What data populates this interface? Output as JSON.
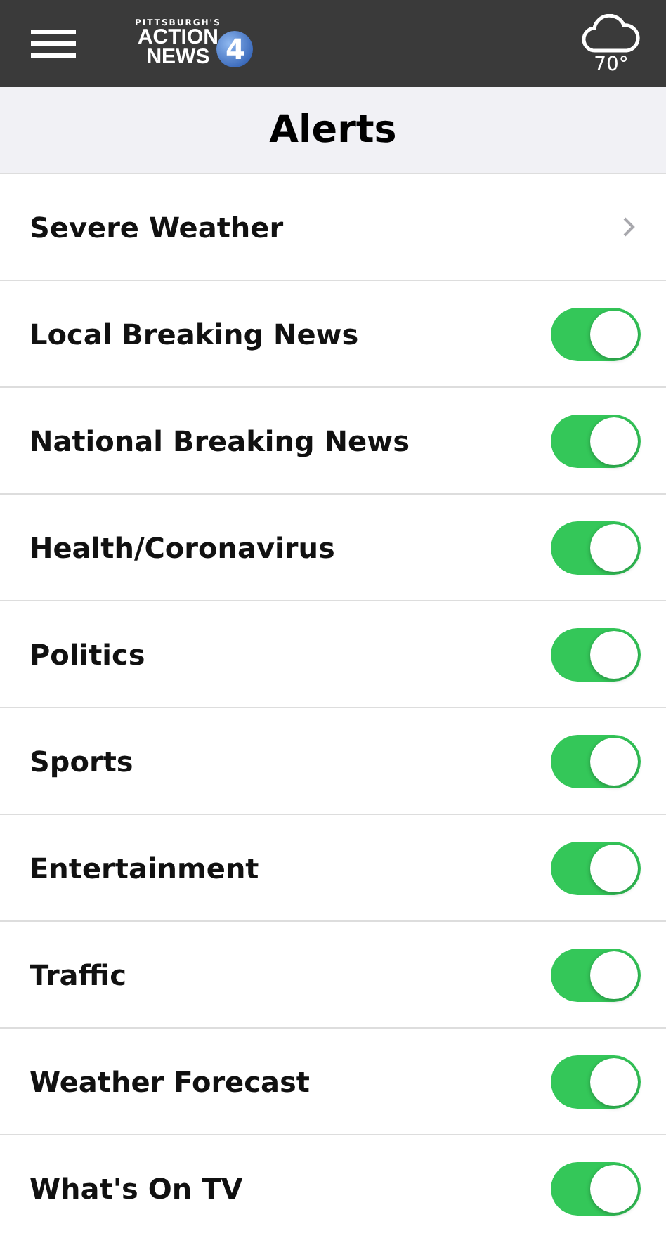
{
  "header": {
    "logo": {
      "top": "PITTSBURGH'S",
      "line1": "ACTION",
      "line2": "NEWS",
      "number": "4"
    },
    "weather": {
      "temperature": "70°"
    }
  },
  "title": "Alerts",
  "alerts": [
    {
      "label": "Severe Weather",
      "kind": "link"
    },
    {
      "label": "Local Breaking News",
      "kind": "toggle",
      "on": true
    },
    {
      "label": "National Breaking News",
      "kind": "toggle",
      "on": true
    },
    {
      "label": "Health/Coronavirus",
      "kind": "toggle",
      "on": true
    },
    {
      "label": "Politics",
      "kind": "toggle",
      "on": true
    },
    {
      "label": "Sports",
      "kind": "toggle",
      "on": true
    },
    {
      "label": "Entertainment",
      "kind": "toggle",
      "on": true
    },
    {
      "label": "Traffic",
      "kind": "toggle",
      "on": true
    },
    {
      "label": "Weather Forecast",
      "kind": "toggle",
      "on": true
    },
    {
      "label": "What's On TV",
      "kind": "toggle",
      "on": true
    }
  ]
}
